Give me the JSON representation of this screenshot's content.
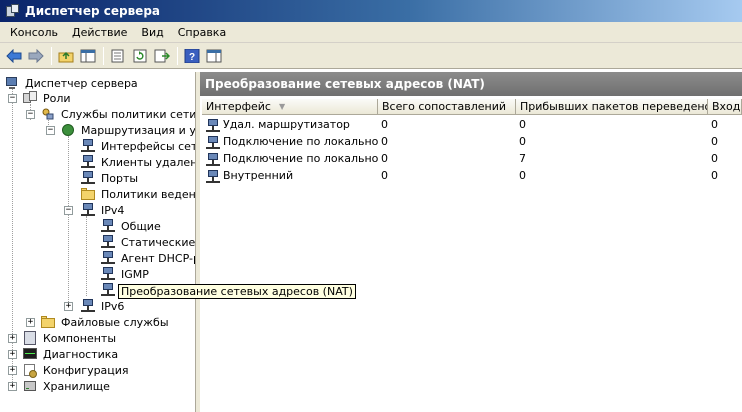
{
  "window": {
    "title": "Диспетчер сервера",
    "icon": "server-manager-icon"
  },
  "menu": [
    "Консоль",
    "Действие",
    "Вид",
    "Справка"
  ],
  "toolbar": {
    "icons": [
      "back-arrow-icon",
      "forward-arrow-icon",
      "up-folder-icon",
      "show-hide-tree-icon",
      "properties-icon",
      "refresh-icon",
      "export-list-icon",
      "help-icon",
      "show-hide-action-pane-icon"
    ]
  },
  "tree": {
    "items": [
      {
        "label": "Диспетчер сервера",
        "icon": "computer-icon"
      },
      {
        "label": "Роли",
        "icon": "roles-icon"
      },
      {
        "label": "Службы политики сети и",
        "icon": "network-policy-icon"
      },
      {
        "label": "Маршрутизация и уда",
        "icon": "routing-icon"
      },
      {
        "label": "Интерфейсы сети",
        "icon": "network-interface-icon"
      },
      {
        "label": "Клиенты удаленн",
        "icon": "network-interface-icon"
      },
      {
        "label": "Порты",
        "icon": "network-interface-icon"
      },
      {
        "label": "Политики ведения",
        "icon": "folder-icon"
      },
      {
        "label": "IPv4",
        "icon": "network-interface-icon"
      },
      {
        "label": "Общие",
        "icon": "network-interface-icon"
      },
      {
        "label": "Статические м",
        "icon": "network-interface-icon"
      },
      {
        "label": "Агент DHCP-ре",
        "icon": "network-interface-icon"
      },
      {
        "label": "IGMP",
        "icon": "network-interface-icon"
      },
      {
        "label": "Преобразование сетевых адресов (NAT)",
        "icon": "network-interface-icon",
        "selected": true
      },
      {
        "label": "IPv6",
        "icon": "network-interface-icon"
      },
      {
        "label": "Файловые службы",
        "icon": "folder-icon"
      },
      {
        "label": "Компоненты",
        "icon": "components-icon"
      },
      {
        "label": "Диагностика",
        "icon": "diagnostics-icon"
      },
      {
        "label": "Конфигурация",
        "icon": "configuration-icon"
      },
      {
        "label": "Хранилище",
        "icon": "storage-icon"
      }
    ]
  },
  "main": {
    "header": "Преобразование сетевых адресов (NAT)",
    "columns": [
      "Интерфейс",
      "Всего сопоставлений",
      "Прибывших пакетов переведено",
      "Входя"
    ],
    "rows": [
      {
        "interface": "Удал. маршрутизатор",
        "mappings": "0",
        "inbound": "0",
        "other": "0"
      },
      {
        "interface": "Подключение по локальной...",
        "mappings": "0",
        "inbound": "0",
        "other": "0"
      },
      {
        "interface": "Подключение по локальной...",
        "mappings": "0",
        "inbound": "7",
        "other": "0"
      },
      {
        "interface": "Внутренний",
        "mappings": "0",
        "inbound": "0",
        "other": "0"
      }
    ]
  },
  "colors": {
    "title_bar": "#0a246a",
    "pane_header": "#7a7a7a",
    "chrome": "#ece9d8"
  }
}
